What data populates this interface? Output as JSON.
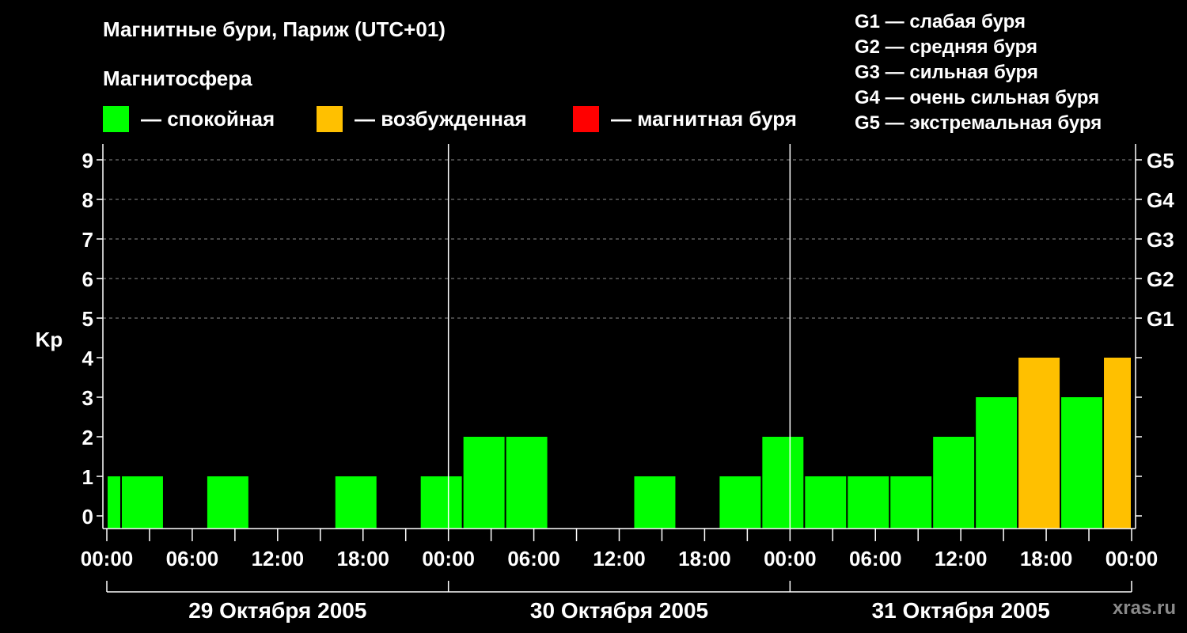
{
  "header": {
    "title": "Магнитные бури, Париж (UTC+01)",
    "magnetosphere_label": "Магнитосфера"
  },
  "legend": {
    "items": [
      {
        "label": "— спокойная",
        "color": "#00ff00"
      },
      {
        "label": "— возбужденная",
        "color": "#ffc000"
      },
      {
        "label": "— магнитная буря",
        "color": "#ff0000"
      }
    ]
  },
  "g_legend": [
    "G1 — слабая буря",
    "G2 — средняя буря",
    "G3 — сильная буря",
    "G4 — очень сильная буря",
    "G5 — экстремальная буря"
  ],
  "watermark": "xras.ru",
  "chart_data": {
    "type": "bar",
    "ylabel": "Kp",
    "ylim": [
      0,
      9
    ],
    "y_ticks": [
      "0",
      "1",
      "2",
      "3",
      "4",
      "5",
      "6",
      "7",
      "8",
      "9"
    ],
    "g_levels": [
      {
        "kp": 5,
        "label": "G1"
      },
      {
        "kp": 6,
        "label": "G2"
      },
      {
        "kp": 7,
        "label": "G3"
      },
      {
        "kp": 8,
        "label": "G4"
      },
      {
        "kp": 9,
        "label": "G5"
      }
    ],
    "x_tick_labels": [
      "00:00",
      "06:00",
      "12:00",
      "18:00",
      "00:00",
      "06:00",
      "12:00",
      "18:00",
      "00:00",
      "06:00",
      "12:00",
      "18:00",
      "00:00"
    ],
    "days": [
      "29 Октября 2005",
      "30 Октября 2005",
      "31 Октября 2005"
    ],
    "colors": {
      "quiet": "#00ff00",
      "active": "#ffc000",
      "storm": "#ff0000"
    },
    "bars": [
      {
        "start": "29 Октября 2005 00:00",
        "end": "29 Октября 2005 01:00",
        "kp": 1,
        "state": "quiet"
      },
      {
        "start": "29 Октября 2005 01:00",
        "end": "29 Октября 2005 04:00",
        "kp": 1,
        "state": "quiet"
      },
      {
        "start": "29 Октября 2005 04:00",
        "end": "29 Октября 2005 07:00",
        "kp": 0,
        "state": "quiet"
      },
      {
        "start": "29 Октября 2005 07:00",
        "end": "29 Октября 2005 10:00",
        "kp": 1,
        "state": "quiet"
      },
      {
        "start": "29 Октября 2005 10:00",
        "end": "29 Октября 2005 13:00",
        "kp": 0,
        "state": "quiet"
      },
      {
        "start": "29 Октября 2005 13:00",
        "end": "29 Октября 2005 16:00",
        "kp": 0,
        "state": "quiet"
      },
      {
        "start": "29 Октября 2005 16:00",
        "end": "29 Октября 2005 19:00",
        "kp": 1,
        "state": "quiet"
      },
      {
        "start": "29 Октября 2005 19:00",
        "end": "29 Октября 2005 22:00",
        "kp": 0,
        "state": "quiet"
      },
      {
        "start": "29 Октября 2005 22:00",
        "end": "30 Октября 2005 01:00",
        "kp": 1,
        "state": "quiet"
      },
      {
        "start": "30 Октября 2005 01:00",
        "end": "30 Октября 2005 04:00",
        "kp": 2,
        "state": "quiet"
      },
      {
        "start": "30 Октября 2005 04:00",
        "end": "30 Октября 2005 07:00",
        "kp": 2,
        "state": "quiet"
      },
      {
        "start": "30 Октября 2005 07:00",
        "end": "30 Октября 2005 10:00",
        "kp": 0,
        "state": "quiet"
      },
      {
        "start": "30 Октября 2005 10:00",
        "end": "30 Октября 2005 13:00",
        "kp": 0,
        "state": "quiet"
      },
      {
        "start": "30 Октября 2005 13:00",
        "end": "30 Октября 2005 16:00",
        "kp": 1,
        "state": "quiet"
      },
      {
        "start": "30 Октября 2005 16:00",
        "end": "30 Октября 2005 19:00",
        "kp": 0,
        "state": "quiet"
      },
      {
        "start": "30 Октября 2005 19:00",
        "end": "30 Октября 2005 22:00",
        "kp": 1,
        "state": "quiet"
      },
      {
        "start": "30 Октября 2005 22:00",
        "end": "31 Октября 2005 01:00",
        "kp": 2,
        "state": "quiet"
      },
      {
        "start": "31 Октября 2005 01:00",
        "end": "31 Октября 2005 04:00",
        "kp": 1,
        "state": "quiet"
      },
      {
        "start": "31 Октября 2005 04:00",
        "end": "31 Октября 2005 07:00",
        "kp": 1,
        "state": "quiet"
      },
      {
        "start": "31 Октября 2005 07:00",
        "end": "31 Октября 2005 10:00",
        "kp": 1,
        "state": "quiet"
      },
      {
        "start": "31 Октября 2005 10:00",
        "end": "31 Октября 2005 13:00",
        "kp": 2,
        "state": "quiet"
      },
      {
        "start": "31 Октября 2005 13:00",
        "end": "31 Октября 2005 16:00",
        "kp": 3,
        "state": "quiet"
      },
      {
        "start": "31 Октября 2005 16:00",
        "end": "31 Октября 2005 19:00",
        "kp": 4,
        "state": "active"
      },
      {
        "start": "31 Октября 2005 19:00",
        "end": "31 Октября 2005 22:00",
        "kp": 3,
        "state": "quiet"
      },
      {
        "start": "31 Октября 2005 22:00",
        "end": "01 Ноября 2005 00:00",
        "kp": 4,
        "state": "active"
      }
    ]
  }
}
